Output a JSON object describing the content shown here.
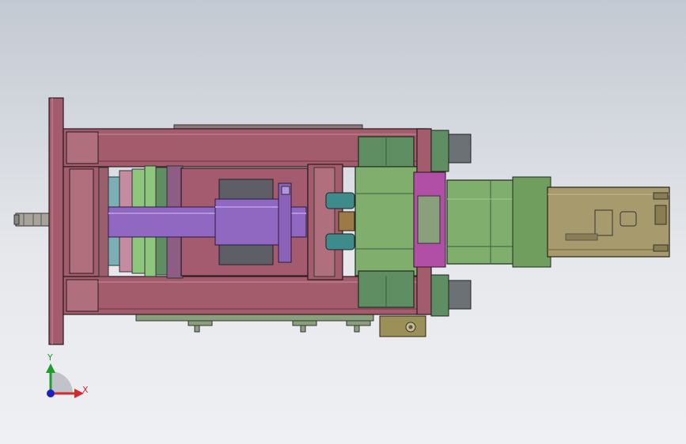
{
  "viewport": {
    "background_top": "#c3c9d2",
    "background_bottom": "#eef0f3"
  },
  "model": {
    "colors": {
      "frame": "#a25c6c",
      "frame_light": "#bf7b89",
      "frame_dark": "#5c2b36",
      "plate_violet": "#8d5d86",
      "rod_purple": "#9068c2",
      "rod_light": "#b594e0",
      "block_gray": "#5e5e66",
      "green_light": "#8ec67d",
      "green_dark": "#5f8e63",
      "motor_green": "#7fae6d",
      "motor_body": "#a79a6c",
      "teal": "#7ab0b5",
      "bronze": "#9b7a45",
      "magenta": "#b04fa5"
    }
  },
  "triad": {
    "x_label": "X",
    "y_label": "Y",
    "x_color": "#d42a2a",
    "y_color": "#1d9d2b",
    "z_color": "#1e1ec8"
  }
}
